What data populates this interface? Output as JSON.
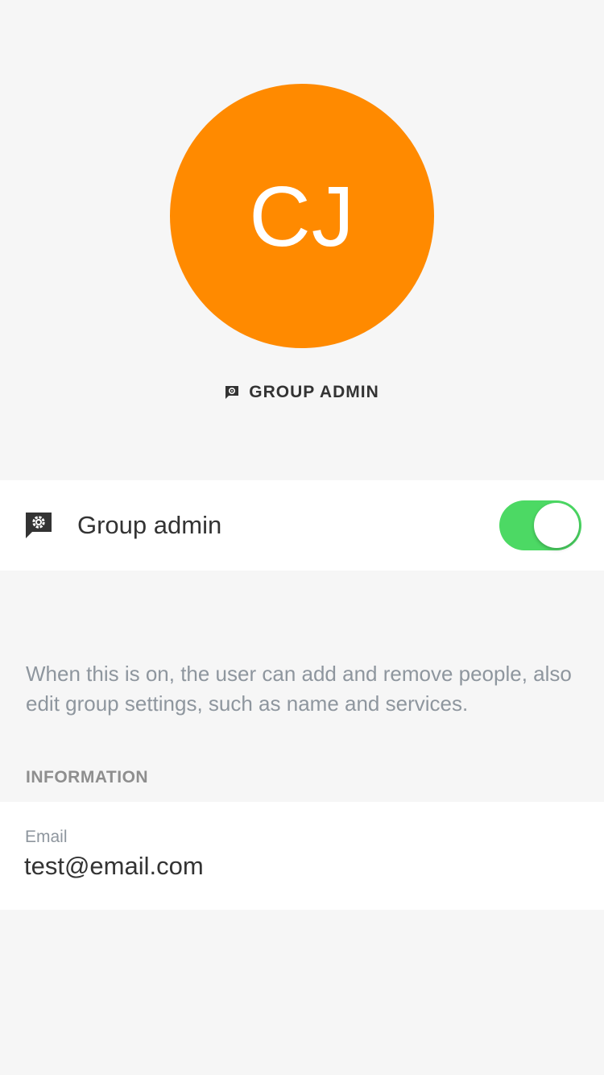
{
  "profile": {
    "initials": "CJ",
    "avatar_color": "#ff8a00",
    "role_badge_icon": "admin-badge-icon",
    "role_badge_label": "GROUP ADMIN"
  },
  "admin_toggle": {
    "icon": "admin-badge-icon",
    "label": "Group admin",
    "enabled": true,
    "on_color": "#4cd964"
  },
  "help_text": "When this is on, the user can add and remove people, also edit group settings, such as name and services.",
  "information": {
    "header": "INFORMATION",
    "email_label": "Email",
    "email_value": "test@email.com"
  }
}
